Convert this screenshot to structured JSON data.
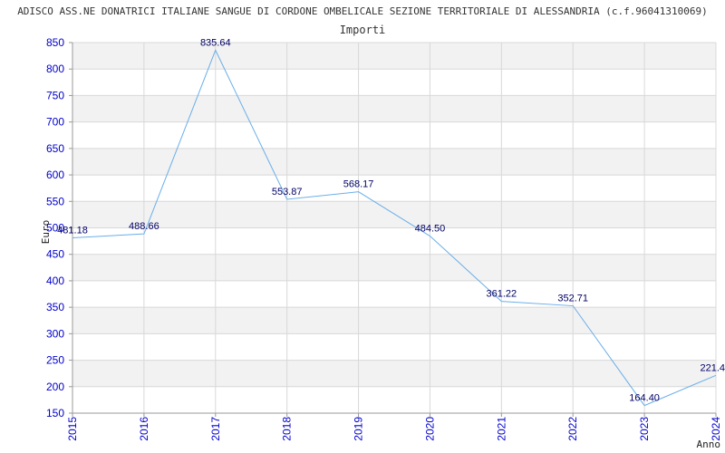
{
  "chart_data": {
    "type": "line",
    "title": "ADISCO ASS.NE DONATRICI ITALIANE SANGUE DI CORDONE OMBELICALE SEZIONE TERRITORIALE DI ALESSANDRIA (c.f.96041310069)",
    "subtitle": "Importi",
    "xlabel": "Anno",
    "ylabel": "Euro",
    "categories": [
      "2015",
      "2016",
      "2017",
      "2018",
      "2019",
      "2020",
      "2021",
      "2022",
      "2023",
      "2024"
    ],
    "values": [
      481.18,
      488.66,
      835.64,
      553.87,
      568.17,
      484.5,
      361.22,
      352.71,
      164.4,
      221.4
    ],
    "value_labels": [
      "481.18",
      "488.66",
      "835.64",
      "553.87",
      "568.17",
      "484.50",
      "361.22",
      "352.71",
      "164.40",
      "221.4"
    ],
    "ylim": [
      150,
      850
    ],
    "yticks": [
      150,
      200,
      250,
      300,
      350,
      400,
      450,
      500,
      550,
      600,
      650,
      700,
      750,
      800,
      850
    ],
    "grid": true,
    "colors": {
      "line": "#6aaee8",
      "band": "#f2f2f2",
      "grid": "#d8d8d8",
      "tick": "#0000cc",
      "label": "#000066"
    }
  }
}
